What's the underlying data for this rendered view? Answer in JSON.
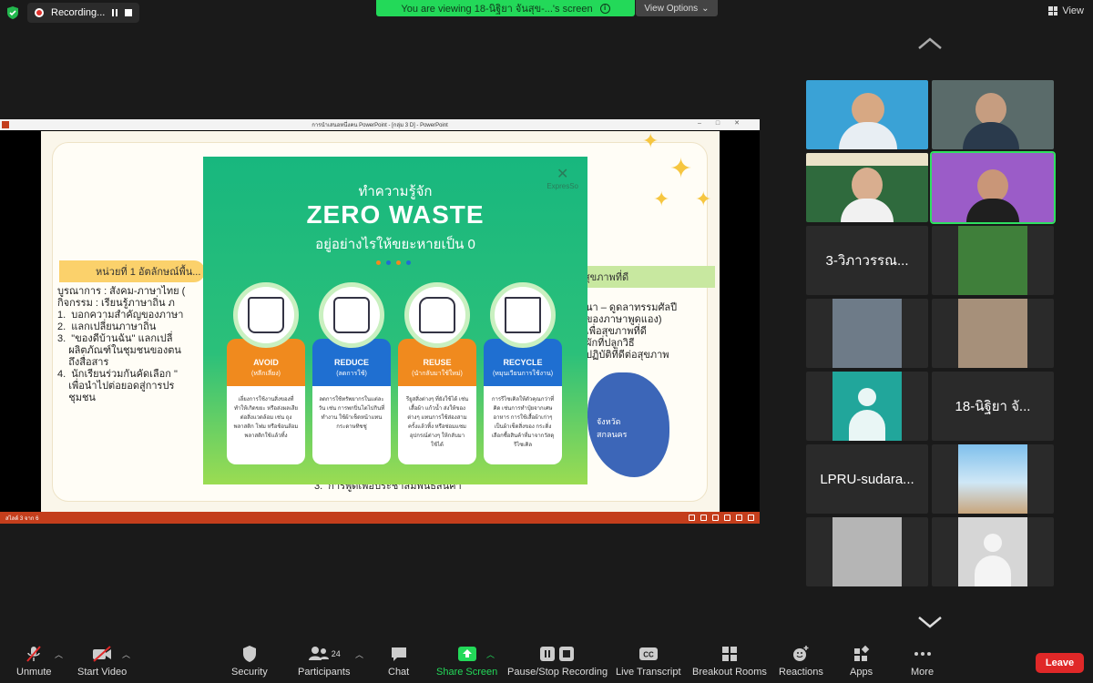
{
  "top_bar": {
    "recording_label": "Recording...",
    "viewing_text": "You are viewing 18-นิฐิยา จันสุข-...'s screen",
    "view_options_label": "View Options",
    "view_label": "View"
  },
  "powerpoint": {
    "title": "การนำเสนอหนึ่งคน PowerPoint - [กลุ่ม 3 D] - PowerPoint",
    "status": "สไลด์ 3 จาก 6"
  },
  "slide": {
    "band_left": "หน่วยที่ 1 อัตลักษณ์พื้น...",
    "band_right": "3 สู่สุขภาพที่ดี",
    "left_text": "บูรณาการ : สังคม-ภาษาไทย (\nกิจกรรม : เรียนรู้ภาษาถิ่น ภ\n1.  บอกความสำคัญของภาษา\n2.  แลกเปลี่ยนภาษาถิ่น\n3.  \"ของดีบ้านฉัน\" แลกเปลี่\n    ผลิตภัณฑ์ในชุมชนของตน\n    ถึงสื่อสาร\n4.  นักเรียนร่วมกันคัดเลือก \"\n    เพื่อนำไปต่อยอดสู่การปร\n    ชุมชน",
    "right_text": "นา – ดูดลาทรรมศัลปี\nของภาษาพูดแอง)\nเพื่อสุขภาพที่ดี\nผักที่ปลูกวิธี\nปฏิบัติที่ดีต่อสุขภาพ",
    "bottom_text": "3.  การพูดเพื่อประชาสัมพันธ์สินค้า",
    "map_label_1": "จังหวัด",
    "map_label_2": "สกลนคร"
  },
  "zero_waste": {
    "logo": "ExpresSo",
    "subtitle_top": "ทำความรู้จัก",
    "title": "ZERO WASTE",
    "subtitle_bottom": "อยู่อย่างไรให้ขยะหายเป็น 0",
    "columns": [
      {
        "label": "AVOID",
        "sub": "(หลีกเลี่ยง)",
        "desc": "เลี่ยงการใช้งานสิ่งของที่ทำให้เกิดขยะ หรือส่งผลเสียต่อสิ่งแวดล้อม เช่น ถุงพลาสติก โฟม หรือช้อนส้อมพลาสติกใช้แล้วทิ้ง",
        "color": "#f08a1e",
        "icon": "bag-icon"
      },
      {
        "label": "REDUCE",
        "sub": "(ลดการใช้)",
        "desc": "ลดการใช้ทรัพยากรในแต่ละวัน เช่น การพกปิ่นโตไปกินที่ทำงาน ใช้ผ้าเช็ดหน้าแทนกระดาษทิชชู่",
        "color": "#1f6fd1",
        "icon": "tissue-icon"
      },
      {
        "label": "REUSE",
        "sub": "(นำกลับมาใช้ใหม่)",
        "desc": "รียูสสิ่งต่างๆ ที่ยังใช้ได้ เช่น เสื้อผ้า แก้วน้ำ ส่งให้ของต่างๆ แทนการใช้ส่องสามครั้งแล้วทิ้ง หรือซ่อมแซมอุปกรณ์ต่างๆ ให้กลับมาใช้ได้",
        "color": "#f08a1e",
        "icon": "shirt-icon"
      },
      {
        "label": "RECYCLE",
        "sub": "(หมุนเวียนการใช้งาน)",
        "desc": "การรีไซเคิลให้ตัวคุณกว่าที่คิด เช่นการทำปุ๋ยจากเศษอาหาร การใช้เสื้อผ้าเก่าๆ เป็นผ้าเช็ดสิ่งของ กระดิ่งเลือกซื้อสินค้าที่มาจากวัสดุรีไซเคิล",
        "color": "#1f6fd1",
        "icon": "recycle-bin-icon"
      }
    ]
  },
  "participants": [
    {
      "name": "",
      "kind": "video-man"
    },
    {
      "name": "",
      "kind": "video-woman"
    },
    {
      "name": "",
      "kind": "video-girl"
    },
    {
      "name": "",
      "kind": "video-cartoon"
    },
    {
      "name": "3-วิภาวรรณ...",
      "kind": "name"
    },
    {
      "name": "",
      "kind": "photo-selfie"
    },
    {
      "name": "",
      "kind": "photo-grad"
    },
    {
      "name": "",
      "kind": "photo-building"
    },
    {
      "name": "",
      "kind": "avatar"
    },
    {
      "name": "18-นิฐิยา จั...",
      "kind": "name"
    },
    {
      "name": "LPRU-sudara...",
      "kind": "name"
    },
    {
      "name": "",
      "kind": "photo-sky"
    },
    {
      "name": "",
      "kind": "photo-face"
    },
    {
      "name": "",
      "kind": "avatar-gray"
    }
  ],
  "toolbar": {
    "unmute": "Unmute",
    "start_video": "Start Video",
    "security": "Security",
    "participants": "Participants",
    "participants_count": "24",
    "chat": "Chat",
    "share_screen": "Share Screen",
    "pause_stop": "Pause/Stop Recording",
    "live_transcript": "Live Transcript",
    "breakout": "Breakout Rooms",
    "reactions": "Reactions",
    "apps": "Apps",
    "more": "More",
    "leave": "Leave"
  }
}
